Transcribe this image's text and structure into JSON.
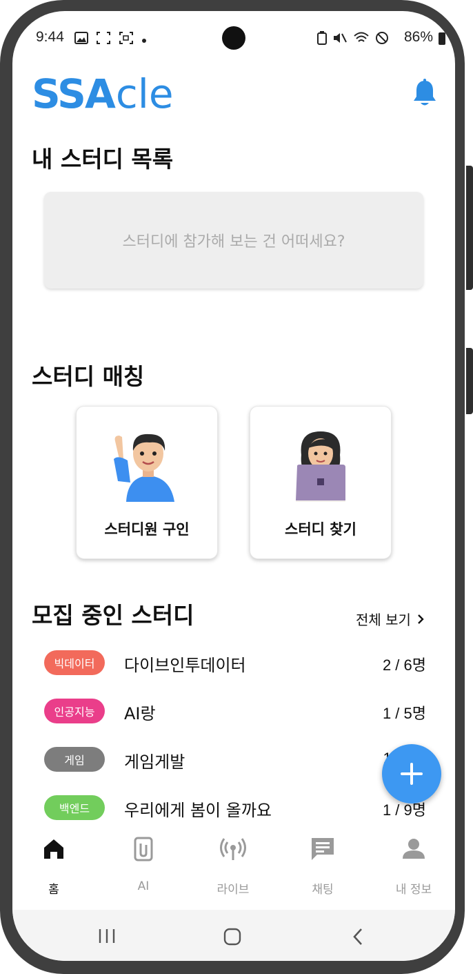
{
  "status_bar": {
    "time": "9:44",
    "battery": "86%"
  },
  "header": {
    "logo_ss": "SSA",
    "logo_cle": "cle"
  },
  "my_studies": {
    "title": "내 스터디 목록",
    "empty_text": "스터디에 참가해 보는 건 어떠세요?"
  },
  "matching": {
    "title": "스터디 매칭",
    "cards": [
      {
        "label": "스터디원 구인"
      },
      {
        "label": "스터디 찾기"
      }
    ]
  },
  "recruiting": {
    "title": "모집 중인 스터디",
    "view_all": "전체 보기",
    "studies": [
      {
        "tag": "빅데이터",
        "tag_color": "#f26a5b",
        "title": "다이브인투데이터",
        "count": "2 / 6명"
      },
      {
        "tag": "인공지능",
        "tag_color": "#ea3e8a",
        "title": "AI랑",
        "count": "1 / 5명"
      },
      {
        "tag": "게임",
        "tag_color": "#7d7d7d",
        "title": "게임게발",
        "count": "1 / "
      },
      {
        "tag": "백엔드",
        "tag_color": "#72cd5c",
        "title": "우리에게 봄이 올까요",
        "count": "1 / 9명"
      }
    ]
  },
  "tabs": [
    {
      "label": "홈",
      "icon": "home-icon",
      "active": true
    },
    {
      "label": "AI",
      "icon": "paperclip-icon",
      "active": false
    },
    {
      "label": "라이브",
      "icon": "broadcast-icon",
      "active": false
    },
    {
      "label": "채팅",
      "icon": "chat-icon",
      "active": false
    },
    {
      "label": "내 정보",
      "icon": "person-icon",
      "active": false
    }
  ],
  "colors": {
    "accent": "#2d8de3",
    "fab": "#3d98f2"
  }
}
